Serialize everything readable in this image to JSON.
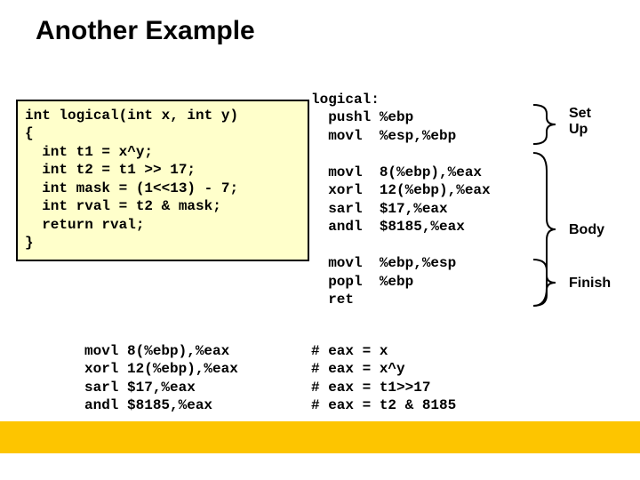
{
  "title": "Another Example",
  "c_code": "int logical(int x, int y)\n{\n  int t1 = x^y;\n  int t2 = t1 >> 17;\n  int mask = (1<<13) - 7;\n  int rval = t2 & mask;\n  return rval;\n}",
  "asm_main": "logical:\n  pushl %ebp\n  movl  %esp,%ebp\n\n  movl  8(%ebp),%eax\n  xorl  12(%ebp),%eax\n  sarl  $17,%eax\n  andl  $8185,%eax\n\n  movl  %ebp,%esp\n  popl  %ebp\n  ret",
  "asm_left": "movl 8(%ebp),%eax\nxorl 12(%ebp),%eax\nsarl $17,%eax\nandl $8185,%eax",
  "asm_comments": "# eax = x\n# eax = x^y\n# eax = t1>>17\n# eax = t2 & 8185",
  "labels": {
    "setup": "Set\nUp",
    "body": "Body",
    "finish": "Finish"
  }
}
